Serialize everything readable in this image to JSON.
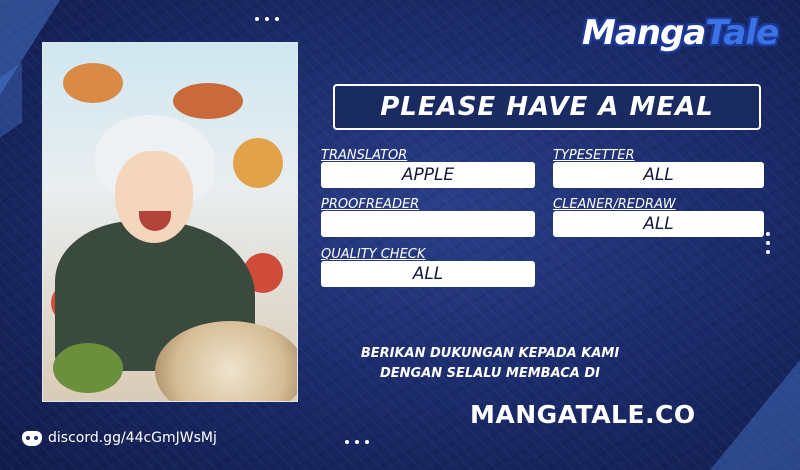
{
  "logo": {
    "part1": "Manga",
    "part2": "Tale"
  },
  "title": "PLEASE HAVE A MEAL",
  "credits": {
    "translator": {
      "label": "TRANSLATOR",
      "value": "APPLE"
    },
    "typesetter": {
      "label": "TYPESETTER",
      "value": "ALL"
    },
    "proofreader": {
      "label": "PROOFREADER",
      "value": ""
    },
    "cleaner": {
      "label": "CLEANER/REDRAW",
      "value": "ALL"
    },
    "quality": {
      "label": "QUALITY CHECK",
      "value": "ALL"
    }
  },
  "support": {
    "line1": "BERIKAN DUKUNGAN KEPADA KAMI",
    "line2": "DENGAN SELALU MEMBACA DI"
  },
  "website": "MANGATALE.CO",
  "discord": {
    "icon": "discord-icon",
    "text": "discord.gg/44cGmJWsMj"
  },
  "colors": {
    "background": "#1c2d6e",
    "accent": "#3b72e6",
    "box": "#ffffff"
  }
}
